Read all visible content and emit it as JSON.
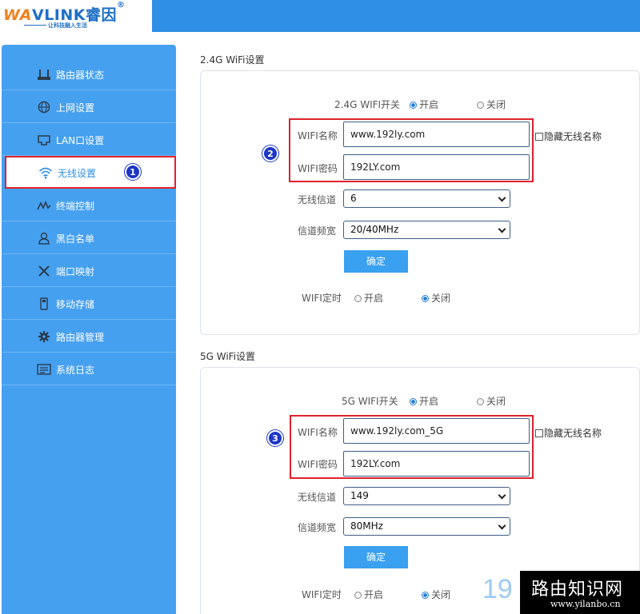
{
  "brand": {
    "name_prefix": "WA",
    "name_rest": "VLINK",
    "name_cn": "睿因",
    "mark": "®",
    "slogan": "让科技融入生活"
  },
  "sidebar": {
    "items": [
      {
        "label": "路由器状态",
        "icon": "router-status-icon"
      },
      {
        "label": "上网设置",
        "icon": "globe-icon"
      },
      {
        "label": "LAN口设置",
        "icon": "lan-port-icon"
      },
      {
        "label": "无线设置",
        "icon": "wifi-icon",
        "active": true
      },
      {
        "label": "终端控制",
        "icon": "pulse-icon"
      },
      {
        "label": "黑白名单",
        "icon": "user-icon"
      },
      {
        "label": "端口映射",
        "icon": "tools-icon"
      },
      {
        "label": "移动存储",
        "icon": "usb-storage-icon"
      },
      {
        "label": "路由器管理",
        "icon": "gear-icon"
      },
      {
        "label": "系统日志",
        "icon": "log-icon"
      }
    ]
  },
  "wifi24": {
    "title": "2.4G WiFi设置",
    "switch_label": "2.4G WIFI开关",
    "on_label": "开启",
    "off_label": "关闭",
    "switch_value": "开启",
    "ssid_label": "WIFI名称",
    "ssid_value": "www.192ly.com",
    "password_label": "WIFI密码",
    "password_value": "192LY.com",
    "hide_label": "隐藏无线名称",
    "channel_label": "无线信道",
    "channel_value": "6",
    "bandwidth_label": "信道频宽",
    "bandwidth_value": "20/40MHz",
    "confirm_label": "确定",
    "timer_label": "WIFI定时",
    "timer_value": "关闭"
  },
  "wifi5": {
    "title": "5G WiFi设置",
    "switch_label": "5G WIFI开关",
    "on_label": "开启",
    "off_label": "关闭",
    "switch_value": "开启",
    "ssid_label": "WIFI名称",
    "ssid_value": "www.192ly.com_5G",
    "password_label": "WIFI密码",
    "password_value": "192LY.com",
    "hide_label": "隐藏无线名称",
    "channel_label": "无线信道",
    "channel_value": "149",
    "bandwidth_label": "信道频宽",
    "bandwidth_value": "80MHz",
    "confirm_label": "确定",
    "timer_label": "WIFI定时",
    "timer_value": "关闭"
  },
  "callouts": {
    "step1": "1",
    "step2": "2",
    "step3": "3"
  },
  "watermark": {
    "main": "路由知识网",
    "url": "www.yilanbo.cn",
    "number": "19"
  },
  "colors": {
    "header": "#2f8fe6",
    "sidebar": "#46a0f0",
    "highlight": "#e0212b",
    "callout": "#1b36c8",
    "button": "#3aa0f0"
  }
}
